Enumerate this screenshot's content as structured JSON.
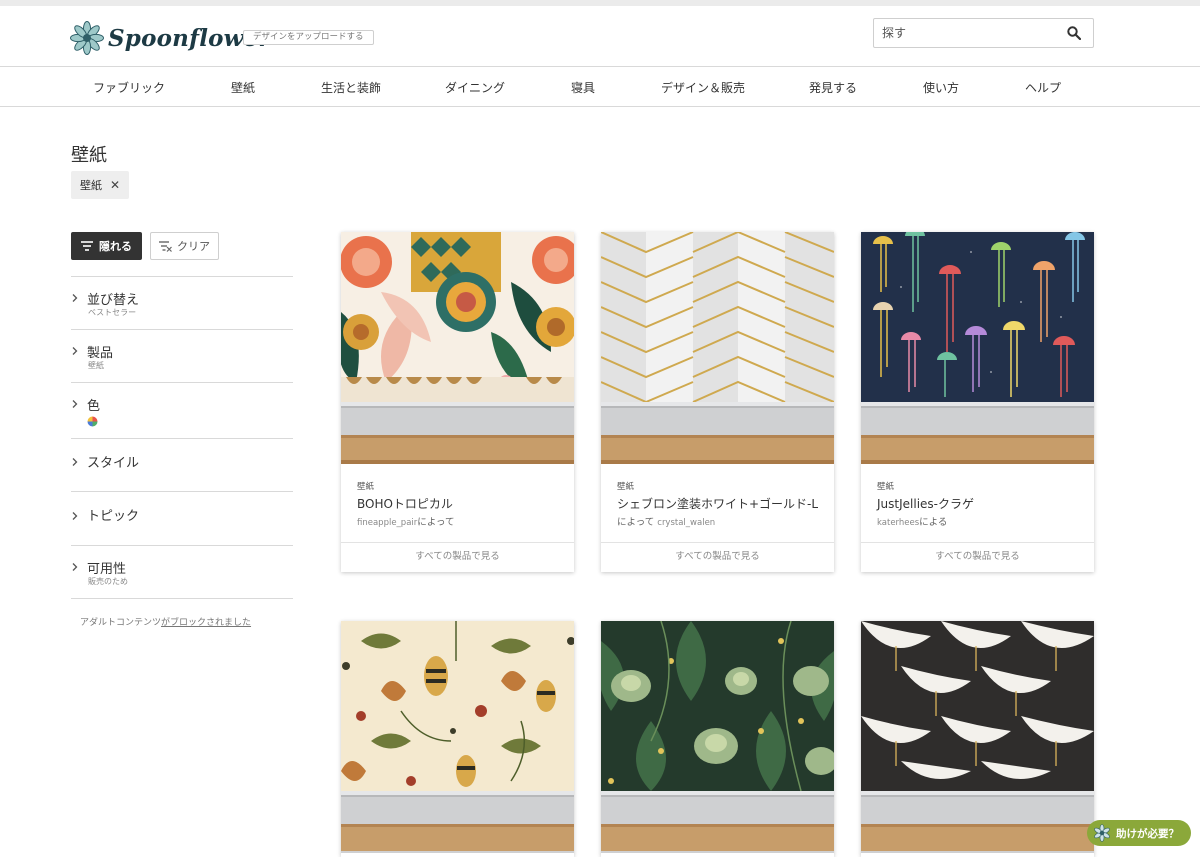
{
  "brand": {
    "name": "Spoonflower",
    "upload_label": "デザインをアップロードする"
  },
  "search": {
    "placeholder": "探す"
  },
  "nav": [
    "ファブリック",
    "壁紙",
    "生活と装飾",
    "ダイニング",
    "寝具",
    "デザイン＆販売",
    "発見する",
    "使い方",
    "ヘルプ"
  ],
  "page": {
    "title": "壁紙",
    "chip": "壁紙",
    "chip_remove": "✕"
  },
  "filters_bar": {
    "hide_label": "隠れる",
    "clear_label": "クリア"
  },
  "filters": [
    {
      "title": "並び替え",
      "sub": "ベストセラー"
    },
    {
      "title": "製品",
      "sub": "壁紙"
    },
    {
      "title": "色",
      "sub": ""
    },
    {
      "title": "スタイル",
      "sub": ""
    },
    {
      "title": "トピック",
      "sub": ""
    },
    {
      "title": "可用性",
      "sub": "販売のため"
    }
  ],
  "adult": {
    "text": "アダルトコンテンツ",
    "link": "がブロックされました"
  },
  "products": [
    {
      "type": "壁紙",
      "title": "BOHOトロピカル",
      "author_user": "fineapple_pair",
      "author_suffix": "によって",
      "author_prefix": "",
      "cta": "すべての製品で見る"
    },
    {
      "type": "壁紙",
      "title": "シェブロン塗装ホワイト+ゴールド-L",
      "author_prefix": "によって ",
      "author_user": "crystal_walen",
      "author_suffix": "",
      "cta": "すべての製品で見る"
    },
    {
      "type": "壁紙",
      "title": "JustJellies-クラゲ",
      "author_user": "katerhees",
      "author_suffix": "による",
      "author_prefix": "",
      "cta": "すべての製品で見る"
    }
  ],
  "help": {
    "label": "助けが必要？"
  },
  "colors": {
    "dark": "#333333",
    "help_green": "#8ba83a",
    "logo_teal": "#2f6f7a"
  }
}
